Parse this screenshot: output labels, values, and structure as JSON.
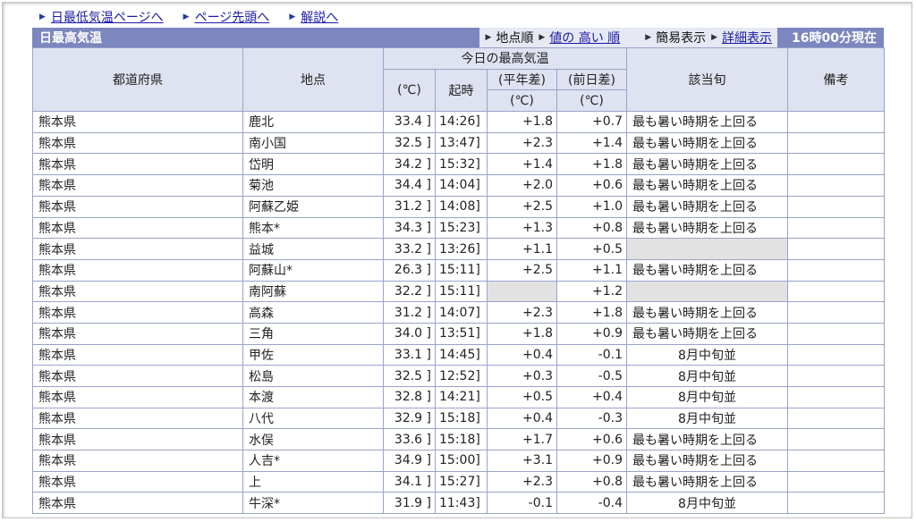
{
  "nav": [
    {
      "label": "日最低気温ページへ"
    },
    {
      "label": "ページ先頭へ"
    },
    {
      "label": "解説へ"
    }
  ],
  "header": {
    "title": "日最高気温",
    "sort_prefix": "地点順",
    "sort_link": "値の 高い 順",
    "view_simple": "簡易表示",
    "view_detail": "詳細表示",
    "time": "16時00分現在"
  },
  "columns": {
    "prefecture": "都道府県",
    "station": "地点",
    "today_group": "今日の最高気温",
    "value": "(℃)",
    "time": "起時",
    "normal_diff_1": "(平年差)",
    "normal_diff_2": "(℃)",
    "prev_diff_1": "(前日差)",
    "prev_diff_2": "(℃)",
    "period": "該当旬",
    "remarks": "備考"
  },
  "rows": [
    {
      "pref": "熊本県",
      "station": "鹿北",
      "value": "33.4 ]",
      "time": "14:26]",
      "normal": "+1.8",
      "prev": "+0.7",
      "period": "最も暑い時期を上回る",
      "remarks": ""
    },
    {
      "pref": "熊本県",
      "station": "南小国",
      "value": "32.5 ]",
      "time": "13:47]",
      "normal": "+2.3",
      "prev": "+1.4",
      "period": "最も暑い時期を上回る",
      "remarks": ""
    },
    {
      "pref": "熊本県",
      "station": "岱明",
      "value": "34.2 ]",
      "time": "15:32]",
      "normal": "+1.4",
      "prev": "+1.8",
      "period": "最も暑い時期を上回る",
      "remarks": ""
    },
    {
      "pref": "熊本県",
      "station": "菊池",
      "value": "34.4 ]",
      "time": "14:04]",
      "normal": "+2.0",
      "prev": "+0.6",
      "period": "最も暑い時期を上回る",
      "remarks": ""
    },
    {
      "pref": "熊本県",
      "station": "阿蘇乙姫",
      "value": "31.2 ]",
      "time": "14:08]",
      "normal": "+2.5",
      "prev": "+1.0",
      "period": "最も暑い時期を上回る",
      "remarks": ""
    },
    {
      "pref": "熊本県",
      "station": "熊本*",
      "value": "34.3 ]",
      "time": "15:23]",
      "normal": "+1.3",
      "prev": "+0.8",
      "period": "最も暑い時期を上回る",
      "remarks": ""
    },
    {
      "pref": "熊本県",
      "station": "益城",
      "value": "33.2 ]",
      "time": "13:26]",
      "normal": "+1.1",
      "prev": "+0.5",
      "period": "",
      "remarks": ""
    },
    {
      "pref": "熊本県",
      "station": "阿蘇山*",
      "value": "26.3 ]",
      "time": "15:11]",
      "normal": "+2.5",
      "prev": "+1.1",
      "period": "最も暑い時期を上回る",
      "remarks": ""
    },
    {
      "pref": "熊本県",
      "station": "南阿蘇",
      "value": "32.2 ]",
      "time": "15:11]",
      "normal": "",
      "prev": "+1.2",
      "period": "",
      "remarks": ""
    },
    {
      "pref": "熊本県",
      "station": "高森",
      "value": "31.2 ]",
      "time": "14:07]",
      "normal": "+2.3",
      "prev": "+1.8",
      "period": "最も暑い時期を上回る",
      "remarks": ""
    },
    {
      "pref": "熊本県",
      "station": "三角",
      "value": "34.0 ]",
      "time": "13:51]",
      "normal": "+1.8",
      "prev": "+0.9",
      "period": "最も暑い時期を上回る",
      "remarks": ""
    },
    {
      "pref": "熊本県",
      "station": "甲佐",
      "value": "33.1 ]",
      "time": "14:45]",
      "normal": "+0.4",
      "prev": "-0.1",
      "period": "8月中旬並",
      "remarks": ""
    },
    {
      "pref": "熊本県",
      "station": "松島",
      "value": "32.5 ]",
      "time": "12:52]",
      "normal": "+0.3",
      "prev": "-0.5",
      "period": "8月中旬並",
      "remarks": ""
    },
    {
      "pref": "熊本県",
      "station": "本渡",
      "value": "32.8 ]",
      "time": "14:21]",
      "normal": "+0.5",
      "prev": "+0.4",
      "period": "8月中旬並",
      "remarks": ""
    },
    {
      "pref": "熊本県",
      "station": "八代",
      "value": "32.9 ]",
      "time": "15:18]",
      "normal": "+0.4",
      "prev": "-0.3",
      "period": "8月中旬並",
      "remarks": ""
    },
    {
      "pref": "熊本県",
      "station": "水俣",
      "value": "33.6 ]",
      "time": "15:18]",
      "normal": "+1.7",
      "prev": "+0.6",
      "period": "最も暑い時期を上回る",
      "remarks": ""
    },
    {
      "pref": "熊本県",
      "station": "人吉*",
      "value": "34.9 ]",
      "time": "15:00]",
      "normal": "+3.1",
      "prev": "+0.9",
      "period": "最も暑い時期を上回る",
      "remarks": ""
    },
    {
      "pref": "熊本県",
      "station": "上",
      "value": "34.1 ]",
      "time": "15:27]",
      "normal": "+2.3",
      "prev": "+0.8",
      "period": "最も暑い時期を上回る",
      "remarks": ""
    },
    {
      "pref": "熊本県",
      "station": "牛深*",
      "value": "31.9 ]",
      "time": "11:43]",
      "normal": "-0.1",
      "prev": "-0.4",
      "period": "8月中旬並",
      "remarks": ""
    }
  ]
}
